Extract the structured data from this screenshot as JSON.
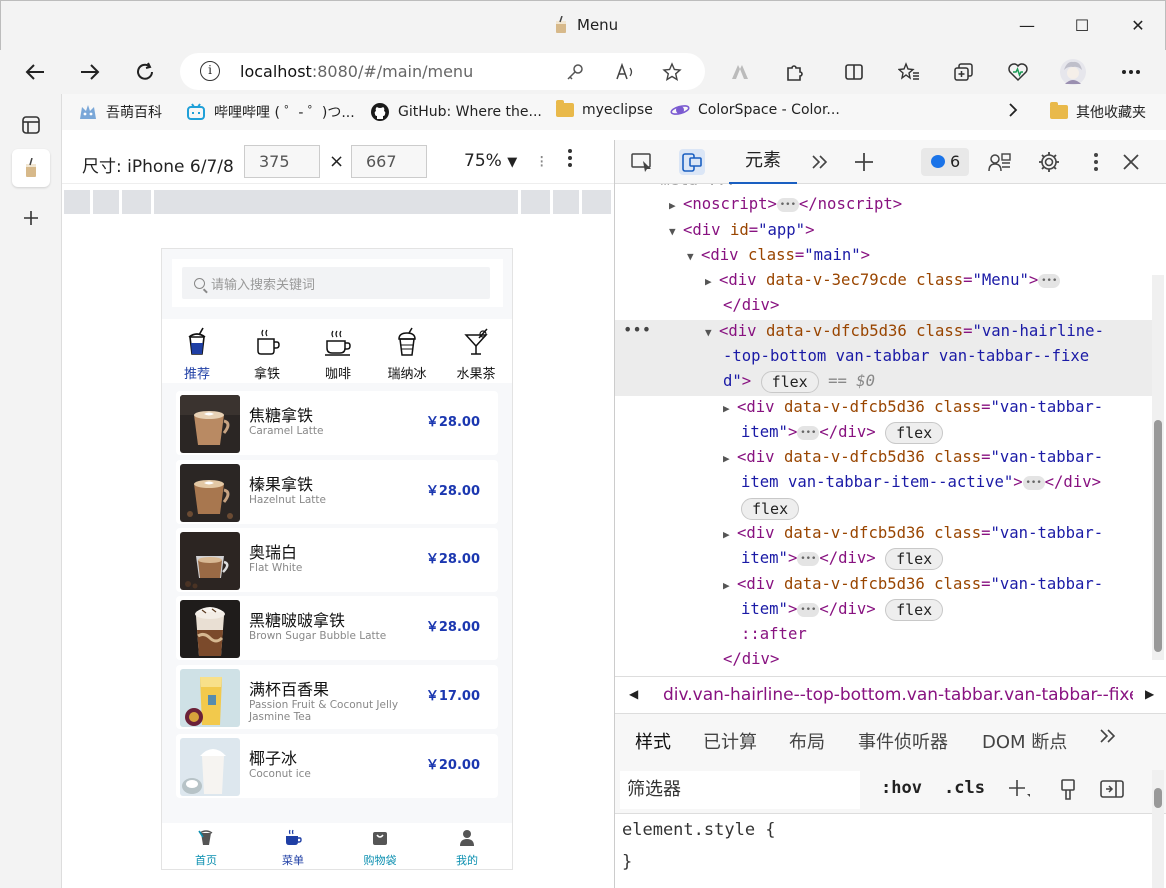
{
  "window": {
    "title": "Menu",
    "minimize": "—",
    "maximize": "☐",
    "close": "✕"
  },
  "address": {
    "host": "localhost",
    "rest": ":8080/#/main/menu"
  },
  "favorites": [
    {
      "label": "吾萌百科",
      "icon": "moe-icon"
    },
    {
      "label": "哔哩哔哩 ( ゜- ゜)つ...",
      "icon": "bilibili-icon"
    },
    {
      "label": "GitHub: Where the...",
      "icon": "github-icon"
    },
    {
      "label": "myeclipse",
      "icon": "folder-icon"
    },
    {
      "label": "ColorSpace - Color...",
      "icon": "colorspace-icon"
    },
    {
      "label": "其他收藏夹",
      "icon": "folder-icon"
    }
  ],
  "device": {
    "label": "尺寸: iPhone 6/7/8",
    "width": "375",
    "height": "667",
    "times": "×",
    "zoom": "75%"
  },
  "app": {
    "search_placeholder": "请输入搜索关键词",
    "categories": [
      {
        "label": "推荐",
        "icon": "recommend-cup-icon",
        "active": true
      },
      {
        "label": "拿铁",
        "icon": "latte-cup-icon",
        "active": false
      },
      {
        "label": "咖啡",
        "icon": "coffee-cup-icon",
        "active": false
      },
      {
        "label": "瑞纳冰",
        "icon": "frappe-cup-icon",
        "active": false
      },
      {
        "label": "水果茶",
        "icon": "fruit-tea-icon",
        "active": false
      }
    ],
    "products": [
      {
        "name": "焦糖拿铁",
        "en": "Caramel Latte",
        "price": "￥28.00"
      },
      {
        "name": "榛果拿铁",
        "en": "Hazelnut Latte",
        "price": "￥28.00"
      },
      {
        "name": "奥瑞白",
        "en": "Flat White",
        "price": "￥28.00"
      },
      {
        "name": "黑糖啵啵拿铁",
        "en": "Brown Sugar Bubble Latte",
        "price": "￥28.00"
      },
      {
        "name": "满杯百香果",
        "en": "Passion Fruit & Coconut Jelly Jasmine Tea",
        "price": "￥17.00"
      },
      {
        "name": "椰子冰",
        "en": "Coconut ice",
        "price": "￥20.00"
      }
    ],
    "tabbar": [
      {
        "label": "首页",
        "icon": "home-icon",
        "active": false
      },
      {
        "label": "菜单",
        "icon": "menu-cup-icon",
        "active": true
      },
      {
        "label": "购物袋",
        "icon": "bag-icon",
        "active": false
      },
      {
        "label": "我的",
        "icon": "user-icon",
        "active": false
      }
    ]
  },
  "devtools": {
    "elements_tab": "元素",
    "issue_count": "6",
    "breadcrumb": "div.van-hairline--top-bottom.van-tabbar.van-tabbar--fixe",
    "style_tabs": [
      "样式",
      "已计算",
      "布局",
      "事件侦听器",
      "DOM 断点"
    ],
    "filter_placeholder": "筛选器",
    "hov": ":hov",
    "cls": ".cls",
    "element_style": "element.style {",
    "close_brace": "}",
    "dom_badge_flex": "flex",
    "dom_eq": "== $0"
  },
  "colors": {
    "accent": "#1f3fa5",
    "price": "#1b37b0",
    "tab_inactive": "#0b8fb0"
  }
}
